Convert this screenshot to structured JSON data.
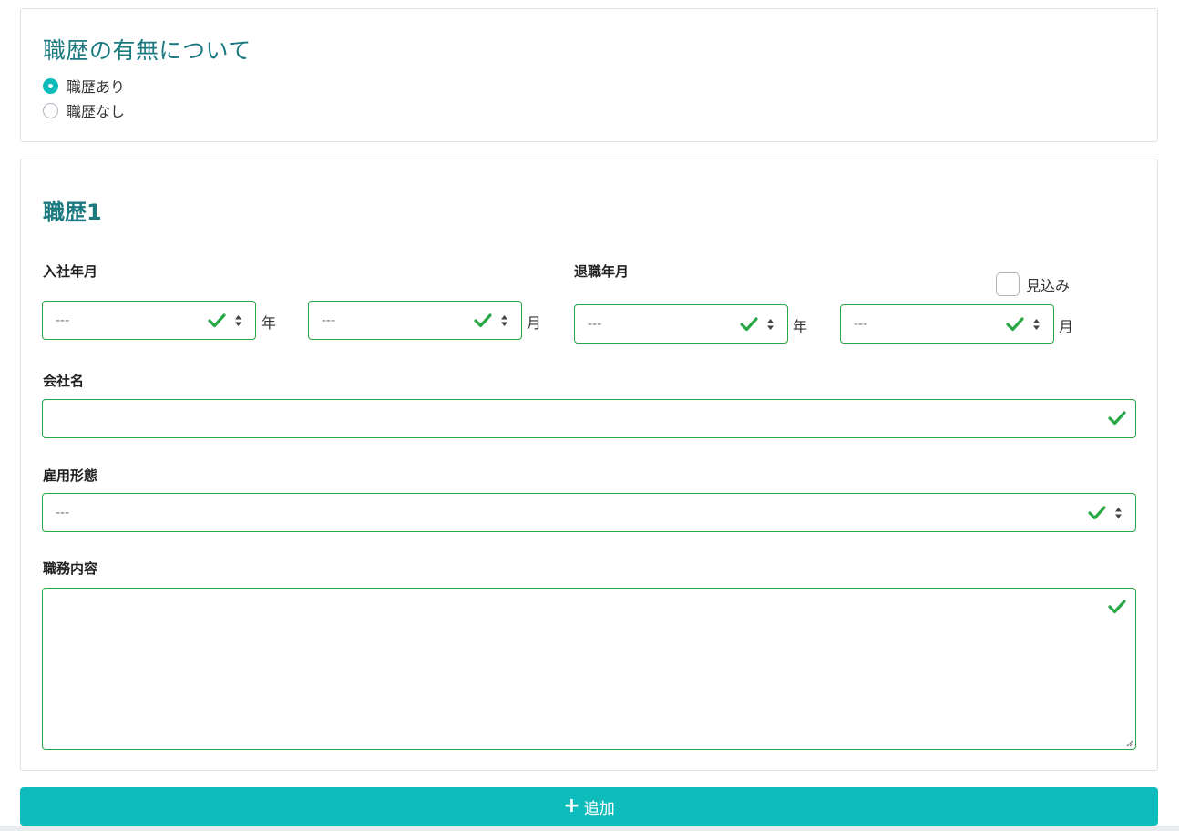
{
  "career_presence": {
    "title": "職歴の有無について",
    "options": [
      {
        "label": "職歴あり",
        "checked": true
      },
      {
        "label": "職歴なし",
        "checked": false
      }
    ]
  },
  "career": {
    "title": "職歴1",
    "join": {
      "label": "入社年月",
      "year_value": "---",
      "year_unit": "年",
      "month_value": "---",
      "month_unit": "月"
    },
    "leave": {
      "label": "退職年月",
      "expected_label": "見込み",
      "year_value": "---",
      "year_unit": "年",
      "month_value": "---",
      "month_unit": "月"
    },
    "company": {
      "label": "会社名",
      "value": ""
    },
    "employment_type": {
      "label": "雇用形態",
      "value": "---"
    },
    "duties": {
      "label": "職務内容",
      "value": ""
    }
  },
  "add_button": {
    "label": "追加",
    "icon": "plus-icon"
  },
  "colors": {
    "accent": "#0fbcbc",
    "valid": "#28a745",
    "heading": "#1b7a80"
  }
}
